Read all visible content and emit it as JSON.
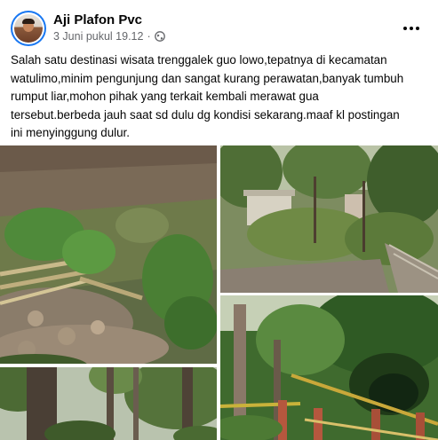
{
  "post": {
    "author": "Aji Plafon Pvc",
    "timestamp": "3 Juni pukul 19.12",
    "separator": "·",
    "privacy_icon": "globe-icon",
    "more_icon": "more-options-icon",
    "text": "Salah satu destinasi wisata trenggalek guo lowo,tepatnya di kecamatan\nwatulimo,minim pengunjung dan sangat kurang perawatan,banyak tumbuh\nrumput liar,mohon pihak yang terkait kembali merawat gua\ntersebut.berbeda  jauh saat sd dulu dg kondisi sekarang.maaf kl postingan\nini menyinggung dulur."
  },
  "colors": {
    "name": "#050505",
    "meta": "#65676b",
    "avatar_ring": "#1877f2"
  },
  "photos": [
    {
      "id": "photo-1",
      "subject": "overgrown stone steps with bamboo"
    },
    {
      "id": "photo-2",
      "subject": "abandoned building among trees"
    },
    {
      "id": "photo-3",
      "subject": "tall tree trunks"
    },
    {
      "id": "photo-4",
      "subject": "cave entrance with railing"
    }
  ]
}
